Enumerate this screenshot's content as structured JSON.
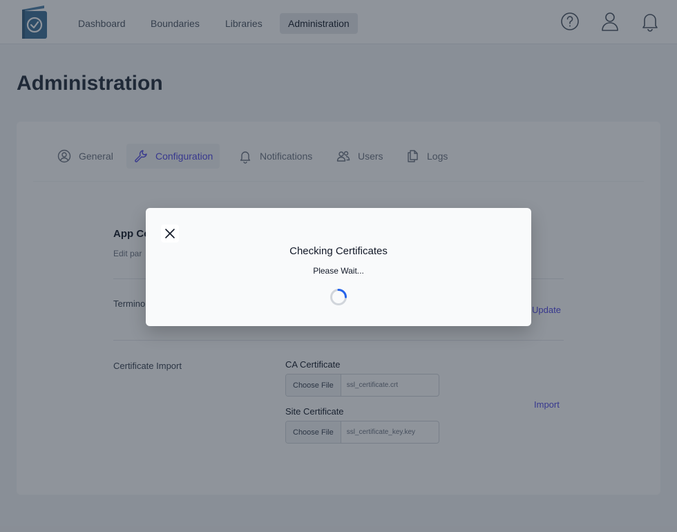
{
  "nav": {
    "items": [
      {
        "label": "Dashboard"
      },
      {
        "label": "Boundaries"
      },
      {
        "label": "Libraries"
      },
      {
        "label": "Administration"
      }
    ]
  },
  "page": {
    "title": "Administration"
  },
  "tabs": [
    {
      "label": "General",
      "icon": "user-circle-icon"
    },
    {
      "label": "Configuration",
      "icon": "wrench-icon"
    },
    {
      "label": "Notifications",
      "icon": "bell-icon"
    },
    {
      "label": "Users",
      "icon": "users-icon"
    },
    {
      "label": "Logs",
      "icon": "documents-icon"
    }
  ],
  "config": {
    "section_title": "App Co",
    "section_sub": "Edit par",
    "terminology_label": "Termino",
    "update_label": "Update",
    "cert_label": "Certificate Import",
    "ca_label": "CA Certificate",
    "ca_button": "Choose File",
    "ca_file": "ssl_certificate.crt",
    "site_label": "Site Certificate",
    "site_button": "Choose File",
    "site_file": "ssl_certificate_key.key",
    "import_label": "Import"
  },
  "modal": {
    "title": "Checking Certificates",
    "subtitle": "Please Wait..."
  },
  "colors": {
    "accent": "#4f46e5",
    "overlay": "#1f2937",
    "spinner": "#2563eb"
  }
}
